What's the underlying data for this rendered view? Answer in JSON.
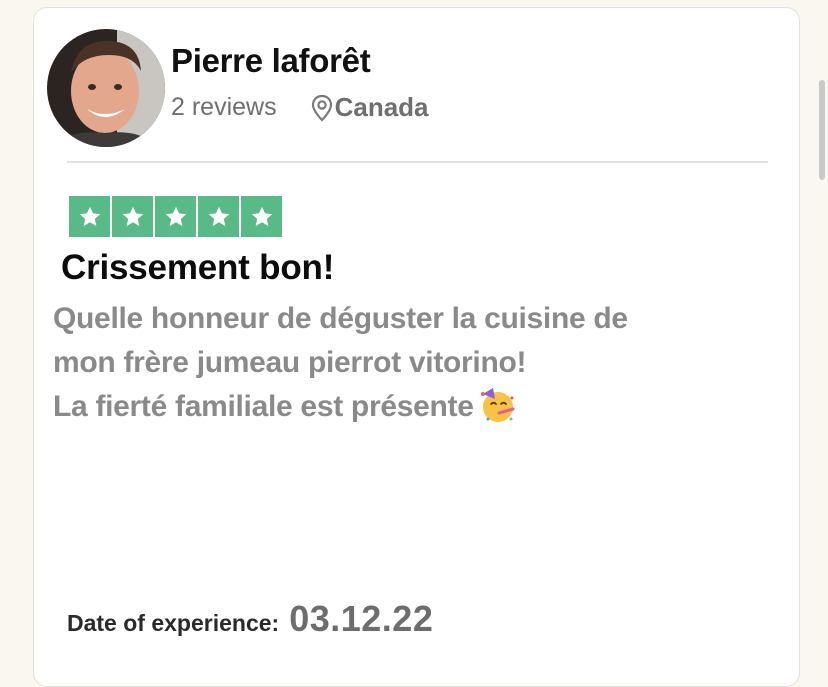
{
  "reviewer": {
    "name": "Pierre laforêt",
    "reviews_count": "2 reviews",
    "country": "Canada",
    "avatar_icon": "reviewer-avatar-photo"
  },
  "rating": {
    "stars": 5,
    "max": 5,
    "star_color": "#58bb87"
  },
  "review": {
    "title": "Crissement bon!",
    "body_lines": [
      "Quelle honneur de déguster la cuisine de",
      "mon frère jumeau pierrot vitorino!",
      "La fierté familiale est présente"
    ],
    "emoji": "partying-face-emoji"
  },
  "experience": {
    "label": "Date of experience:",
    "date": "03.12.22"
  }
}
